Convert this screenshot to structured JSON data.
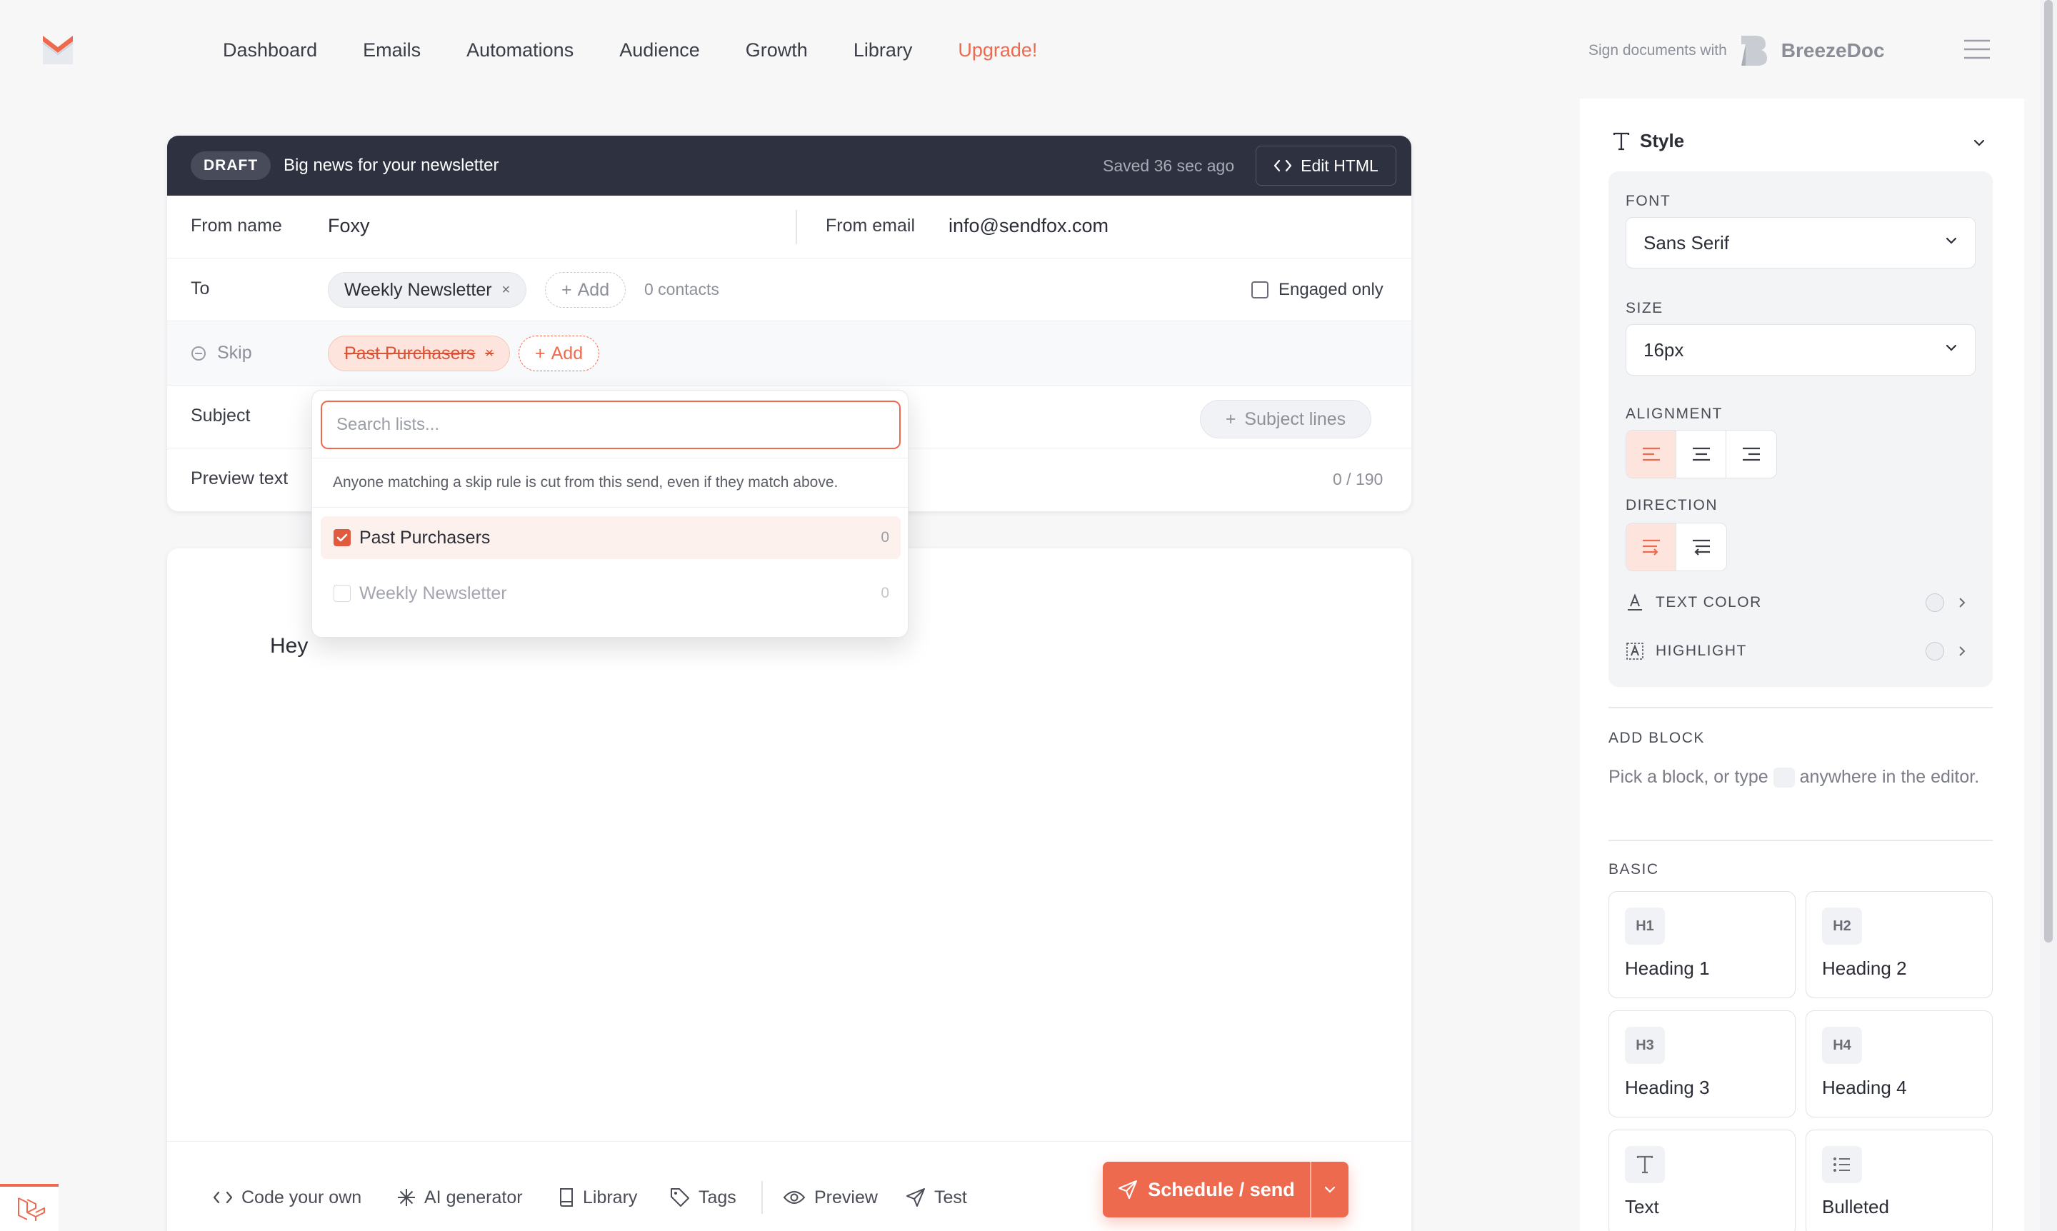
{
  "nav": {
    "items": [
      "Dashboard",
      "Emails",
      "Automations",
      "Audience",
      "Growth",
      "Library"
    ],
    "upgrade": "Upgrade!",
    "sign_prefix": "Sign documents with",
    "sign_brand": "BreezeDoc"
  },
  "composer": {
    "badge": "DRAFT",
    "title": "Big news for your newsletter",
    "saved": "Saved 36 sec ago",
    "edit_html": "Edit HTML",
    "from_name_label": "From name",
    "from_name": "Foxy",
    "from_email_label": "From email",
    "from_email": "info@sendfox.com",
    "to_label": "To",
    "to_chip": "Weekly Newsletter",
    "add": "Add",
    "contacts": "0 contacts",
    "engaged_only": "Engaged only",
    "skip_label": "Skip",
    "skip_chip": "Past Purchasers",
    "subject_label": "Subject",
    "subject_lines": "Subject lines",
    "preview_label": "Preview text",
    "preview_count": "0 / 190"
  },
  "dropdown": {
    "placeholder": "Search lists...",
    "note": "Anyone matching a skip rule is cut from this send, even if they match above.",
    "options": [
      {
        "name": "Past Purchasers",
        "count": "0",
        "checked": true
      },
      {
        "name": "Weekly Newsletter",
        "count": "0",
        "checked": false
      }
    ]
  },
  "editor": {
    "greeting": "Hey",
    "toolbar": [
      "Code your own",
      "AI generator",
      "Library",
      "Tags",
      "Preview",
      "Test"
    ],
    "send": "Schedule / send"
  },
  "panel": {
    "style_title": "Style",
    "font_label": "FONT",
    "font_value": "Sans Serif",
    "size_label": "SIZE",
    "size_value": "16px",
    "alignment_label": "ALIGNMENT",
    "direction_label": "DIRECTION",
    "text_color": "TEXT COLOR",
    "highlight": "HIGHLIGHT",
    "add_block": "ADD BLOCK",
    "add_block_text_1": "Pick a block, or type",
    "add_block_text_2": "anywhere in the editor.",
    "basic": "BASIC",
    "blocks": [
      {
        "icon": "H1",
        "name": "Heading 1"
      },
      {
        "icon": "H2",
        "name": "Heading 2"
      },
      {
        "icon": "H3",
        "name": "Heading 3"
      },
      {
        "icon": "H4",
        "name": "Heading 4"
      },
      {
        "icon": "T",
        "name": "Text"
      },
      {
        "icon": "list",
        "name": "Bulleted"
      }
    ]
  },
  "colors": {
    "accent": "#ee6a4f",
    "header_dark": "#2d3140",
    "accent_soft": "#fde4dd"
  }
}
